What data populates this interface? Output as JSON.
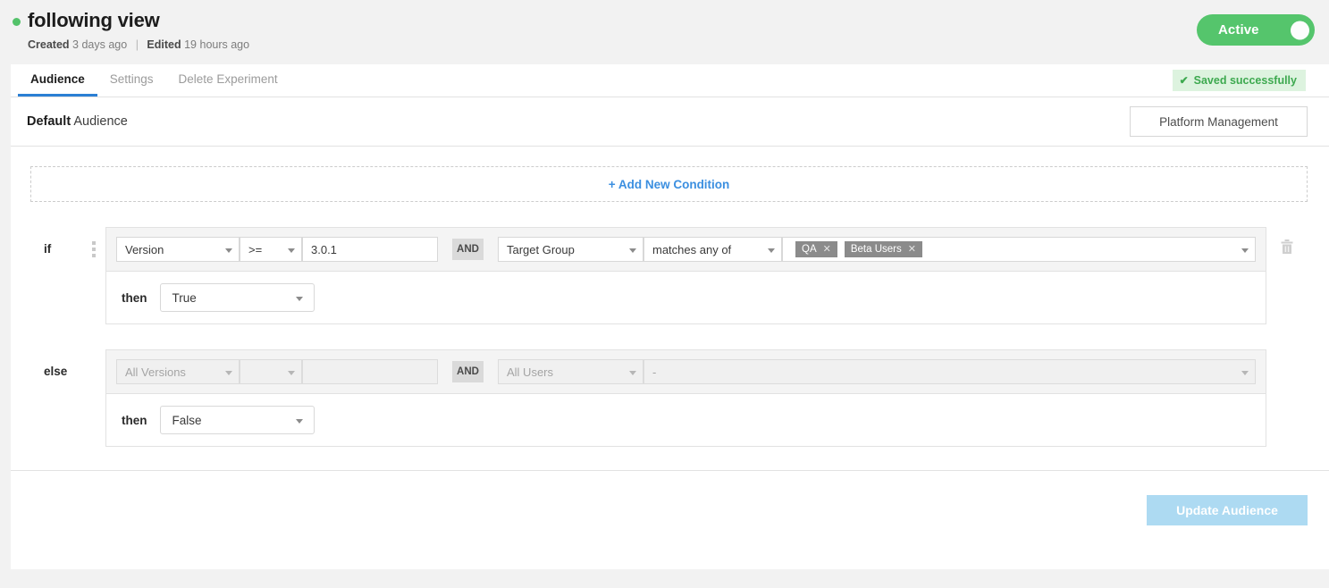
{
  "header": {
    "title": "following view",
    "status_dot_color": "#53c26a",
    "created_label": "Created",
    "created_value": "3 days ago",
    "separator": "|",
    "edited_label": "Edited",
    "edited_value": "19 hours ago",
    "toggle_label": "Active",
    "toggle_color": "#55c56c"
  },
  "tabs": [
    {
      "label": "Audience"
    },
    {
      "label": "Settings"
    },
    {
      "label": "Delete Experiment"
    }
  ],
  "saved": {
    "check": "✔",
    "text": "Saved successfully",
    "color": "#3da94f"
  },
  "audience": {
    "title_bold": "Default",
    "title_rest": " Audience",
    "platform_button": "Platform Management"
  },
  "add_condition": {
    "label": "+ Add New Condition",
    "color": "#3b8fe0"
  },
  "rules": [
    {
      "label": "if",
      "enabled": true,
      "attribute": "Version",
      "operator": ">=",
      "value": "3.0.1",
      "conjunction": "AND",
      "attribute2": "Target Group",
      "match": "matches any of",
      "tags": [
        {
          "label": "QA",
          "close": "✕"
        },
        {
          "label": "Beta Users",
          "close": "✕"
        }
      ],
      "then_label": "then",
      "then_value": "True",
      "delete_icon": "trash-icon"
    },
    {
      "label": "else",
      "enabled": false,
      "attribute": "All Versions",
      "operator": "",
      "value": "",
      "conjunction": "AND",
      "attribute2": "All Users",
      "match": "-",
      "tags": [],
      "then_label": "then",
      "then_value": "False",
      "delete_icon": ""
    }
  ],
  "footer": {
    "update_button": "Update Audience",
    "update_button_color": "#addaf2"
  }
}
